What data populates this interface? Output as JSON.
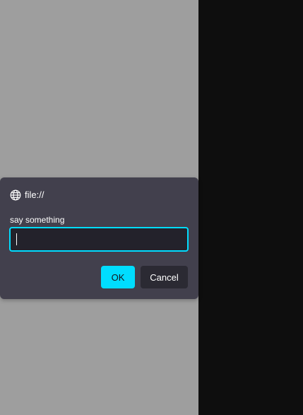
{
  "dialog": {
    "origin": "file://",
    "origin_icon": "globe-icon",
    "message": "say something",
    "input_value": "",
    "input_placeholder": "",
    "ok_label": "OK",
    "cancel_label": "Cancel"
  },
  "colors": {
    "page_background_left": "#9e9e9e",
    "page_background_right": "#0e0e0e",
    "dialog_background": "#42404d",
    "input_background": "#23222b",
    "accent": "#00ddff",
    "cancel_background": "#2b2a33",
    "text": "#ffffff"
  }
}
